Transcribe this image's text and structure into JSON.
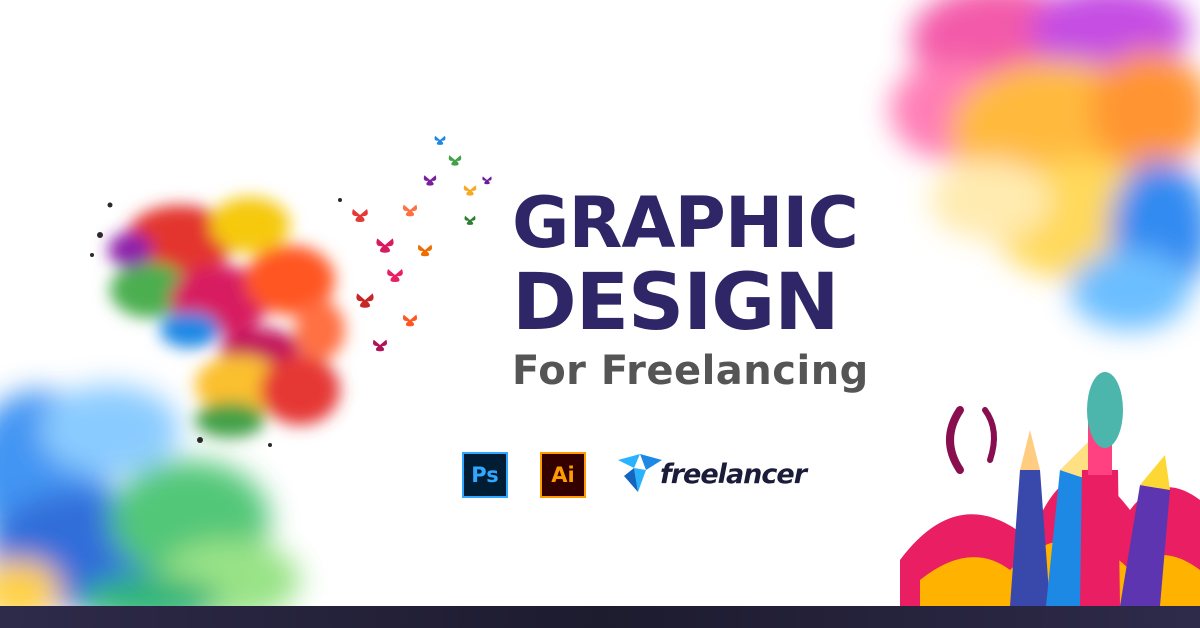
{
  "headline": {
    "line1": "GRAPHIC",
    "line2": "DESIGN",
    "subtitle": "For Freelancing"
  },
  "logos": {
    "photoshop": "Ps",
    "illustrator": "Ai",
    "freelancer": "freelancer"
  },
  "colors": {
    "title": "#2e2666",
    "subtitle": "#555555",
    "photoshop_accent": "#31a8ff",
    "illustrator_accent": "#ff9a00",
    "freelancer_blue": "#29b2fe",
    "bottom_bar": "#1d1b2e"
  },
  "icons": [
    "butterfly-splash-icon",
    "pencil-brush-icon",
    "freelancer-bird-icon"
  ]
}
